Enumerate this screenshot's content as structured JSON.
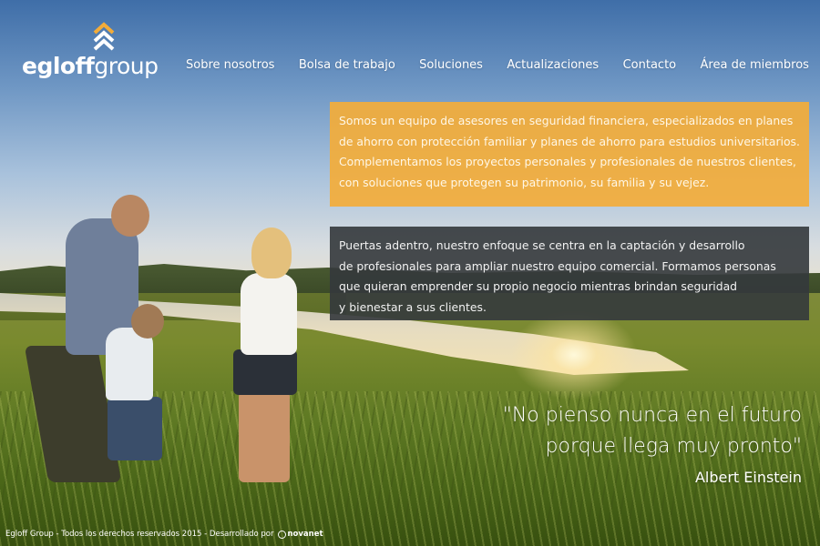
{
  "brand": {
    "name_bold": "egloff",
    "name_light": "group",
    "accent_color": "#f3ac3a"
  },
  "nav": {
    "items": [
      {
        "label": "Sobre nosotros"
      },
      {
        "label": "Bolsa de trabajo"
      },
      {
        "label": "Soluciones"
      },
      {
        "label": "Actualizaciones"
      },
      {
        "label": "Contacto"
      },
      {
        "label": "Área de miembros"
      }
    ]
  },
  "intro": {
    "lines": [
      "Somos un equipo de asesores en seguridad financiera, especializados en planes",
      "de ahorro con protección familiar y planes de ahorro para estudios universitarios.",
      "Complementamos los proyectos personales y profesionales de nuestros clientes,",
      "con soluciones que protegen su patrimonio, su familia y su vejez."
    ]
  },
  "focus": {
    "lines": [
      "Puertas adentro, nuestro enfoque se centra en la captación y desarrollo",
      "de profesionales para ampliar nuestro equipo comercial. Formamos personas",
      "que quieran emprender su propio negocio mientras brindan seguridad",
      "y bienestar a sus clientes."
    ]
  },
  "quote": {
    "line1": "\"No pienso nunca en el futuro",
    "line2": "porque llega muy pronto\"",
    "author": "Albert Einstein"
  },
  "footer": {
    "text": "Egloff Group - Todos los derechos reservados 2015 - Desarrollado por",
    "developer": "novanet"
  }
}
